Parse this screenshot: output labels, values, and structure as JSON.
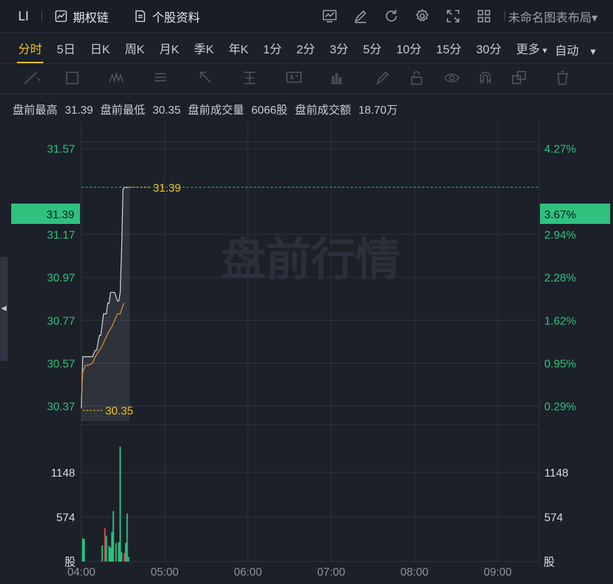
{
  "topbar": {
    "symbol": "LI",
    "options_chain": "期权链",
    "stock_profile": "个股资料",
    "layout_name": "未命名图表布局",
    "icons": [
      "indicator-icon",
      "draw-edit-icon",
      "refresh-icon",
      "settings-icon",
      "fullscreen-icon",
      "grid-layout-icon"
    ]
  },
  "timeframes": {
    "items": [
      "分时",
      "5日",
      "日K",
      "周K",
      "月K",
      "季K",
      "年K",
      "1分",
      "2分",
      "3分",
      "5分",
      "10分",
      "15分",
      "30分",
      "更多"
    ],
    "active": "分时",
    "scale_mode": "自动"
  },
  "drawing_tools": [
    "trend-line-icon",
    "rectangle-icon",
    "wave-icon",
    "fibonacci-icon",
    "arrow-icon",
    "price-range-icon",
    "text-note-icon",
    "measure-icon",
    "pen-icon",
    "lock-icon",
    "eye-icon",
    "magnet-icon",
    "copy-icon",
    "trash-icon"
  ],
  "info": {
    "high_label": "盘前最高",
    "high_value": "31.39",
    "low_label": "盘前最低",
    "low_value": "30.35",
    "volume_label": "盘前成交量",
    "volume_value": "6066股",
    "amount_label": "盘前成交额",
    "amount_value": "18.70万"
  },
  "watermark": "盘前行情",
  "colors": {
    "up": "#2ec27e",
    "down": "#e5484d",
    "price_line": "#d9dde3",
    "avg_line": "#e8953a",
    "label_yellow": "#f0c419",
    "grid": "#2e3440"
  },
  "current_price_tag": {
    "price": "31.39",
    "percent": "3.67%"
  },
  "chart_data": {
    "type": "line",
    "title": "",
    "x_ticks": [
      "04:00",
      "05:00",
      "06:00",
      "07:00",
      "08:00",
      "09:00"
    ],
    "xlim": [
      "04:00",
      "09:30"
    ],
    "price_ticks": [
      "31.57",
      "31.17",
      "30.97",
      "30.77",
      "30.57",
      "30.37"
    ],
    "percent_ticks": [
      "4.27%",
      "2.94%",
      "2.28%",
      "1.62%",
      "0.95%",
      "0.29%"
    ],
    "ylim": [
      30.3,
      31.7
    ],
    "max_marker": "31.39",
    "min_marker": "30.35",
    "series": [
      {
        "x": [
          "04:00",
          "04:01",
          "04:02",
          "04:03",
          "04:05",
          "04:08",
          "04:10",
          "04:11",
          "04:13",
          "04:14",
          "04:16",
          "04:18",
          "04:19",
          "04:20",
          "04:21",
          "04:22",
          "04:23",
          "04:24",
          "04:25",
          "04:26",
          "04:27",
          "04:28",
          "04:29",
          "04:30",
          "04:31",
          "04:32",
          "04:33",
          "04:34",
          "04:35"
        ],
        "values": [
          30.36,
          30.6,
          30.6,
          30.6,
          30.6,
          30.6,
          30.63,
          30.63,
          30.7,
          30.7,
          30.8,
          30.8,
          30.85,
          30.85,
          30.9,
          30.9,
          30.9,
          30.9,
          30.88,
          30.86,
          30.86,
          30.9,
          31.1,
          31.38,
          31.39,
          31.39,
          31.39,
          31.39,
          31.39
        ]
      },
      {
        "x": [
          "04:00",
          "04:01",
          "04:03",
          "04:05",
          "04:08",
          "04:10",
          "04:13",
          "04:15",
          "04:17",
          "04:20",
          "04:22",
          "04:24",
          "04:26",
          "04:28",
          "04:30",
          "04:31"
        ],
        "values": [
          30.4,
          30.53,
          30.56,
          30.56,
          30.57,
          30.6,
          30.63,
          30.65,
          30.68,
          30.72,
          30.74,
          30.77,
          30.8,
          30.8,
          30.84,
          30.85
        ]
      }
    ],
    "volume": {
      "ticks": [
        "1148",
        "574"
      ],
      "unit": "股",
      "ylim": [
        0,
        1720
      ],
      "bars": [
        {
          "x": "04:01",
          "value": 300,
          "dir": "up"
        },
        {
          "x": "04:02",
          "value": 290,
          "dir": "up"
        },
        {
          "x": "04:15",
          "value": 210,
          "dir": "up"
        },
        {
          "x": "04:17",
          "value": 430,
          "dir": "down"
        },
        {
          "x": "04:18",
          "value": 330,
          "dir": "up"
        },
        {
          "x": "04:20",
          "value": 200,
          "dir": "up"
        },
        {
          "x": "04:21",
          "value": 180,
          "dir": "up"
        },
        {
          "x": "04:22",
          "value": 380,
          "dir": "up"
        },
        {
          "x": "04:23",
          "value": 650,
          "dir": "up"
        },
        {
          "x": "04:25",
          "value": 240,
          "dir": "up"
        },
        {
          "x": "04:27",
          "value": 250,
          "dir": "up"
        },
        {
          "x": "04:28",
          "value": 1480,
          "dir": "up"
        },
        {
          "x": "04:29",
          "value": 120,
          "dir": "up"
        },
        {
          "x": "04:31",
          "value": 110,
          "dir": "down"
        },
        {
          "x": "04:32",
          "value": 240,
          "dir": "up"
        },
        {
          "x": "04:33",
          "value": 620,
          "dir": "up"
        },
        {
          "x": "04:34",
          "value": 60,
          "dir": "up"
        }
      ]
    }
  }
}
